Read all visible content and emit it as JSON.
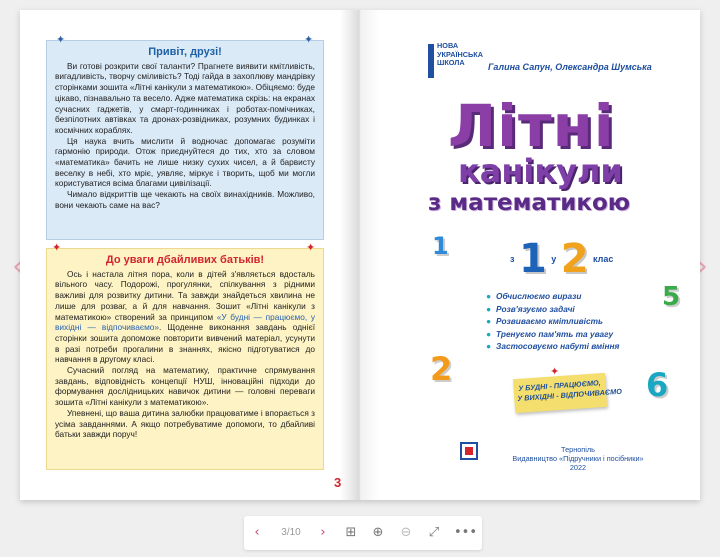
{
  "left_page": {
    "greeting": {
      "title": "Привіт, друзі!",
      "paragraphs": [
        "Ви готові розкрити свої таланти? Прагнете виявити кмітливість, вигадливість, творчу сміливість? Тоді гайда в захоплюву мандрівку сторінками зошита «Літні канікули з математикою». Обіцяємо: буде цікаво, пізнавально та весело. Адже математика скрізь: на екранах сучасних гаджетів, у смарт-годинниках і роботах-помічниках, безпілотних автівках та дронах-розвідниках, розумних будинках і космічних кораблях.",
        "Ця наука вчить мислити й водночас допомагає розуміти гармонію природи. Отож приєднуйтеся до тих, хто за словом «математика» бачить не лише низку сухих чисел, а й барвисту веселку в небі, хто мріє, уявляє, міркує і творить, щоб ми могли користуватися всіма благами цивілізації.",
        "Чимало відкриттів ще чекають на своїх винахідників. Можливо, вони чекають саме на вас?"
      ]
    },
    "parents": {
      "title": "До уваги дбайливих батьків!",
      "p1": "Ось і настала літня пора, коли в дітей з'являється вдосталь вільного часу. Подорожі, прогулянки, спілкування з рідними важливі для розвитку дитини. Та завжди знайдеться хвилина не лише для розваг, а й для навчання. Зошит «Літні канікули з математикою» створений за принципом ",
      "p1_link": "«У будні — працюємо, у вихідні — відпочиваємо»",
      "p1_tail": ". Щоденне виконання завдань однієї сторінки зошита допоможе повторити вивчений матеріал, усунути в разі потреби прогалини в знаннях, якісно підготуватися до навчання в другому класі.",
      "p2": "Сучасний погляд на математику, практичне спрямування завдань, відповідність концепції НУШ, інноваційні підходи до формування дослідницьких навичок дитини — головні переваги зошита «Літні канікули з математикою».",
      "p3": "Упевнені, що ваша дитина залюбки працюватиме і впорається з усіма завданнями. А якщо потребуватиме допомоги, то дбайливі батьки завжди поруч!"
    },
    "page_number": "3"
  },
  "right_page": {
    "logo": "НОВА УКРАЇНСЬКА ШКОЛА",
    "authors": "Галина Сапун, Олександра Шумська",
    "title_line1": "Літні",
    "title_line2": "канікули",
    "title_line3": "з математикою",
    "grade": {
      "prefix": "з",
      "from": "1",
      "middle": "у",
      "to": "2",
      "suffix": "клас"
    },
    "deco_digits": [
      "1",
      "5",
      "2",
      "6"
    ],
    "features": [
      "Обчислюємо вирази",
      "Розв'язуємо задачі",
      "Розвиваємо кмітливість",
      "Тренуємо пам'ять та увагу",
      "Застосовуємо набуті вміння"
    ],
    "sticker": [
      "У БУДНІ - ПРАЦЮЄМО,",
      "У ВИХІДНІ - ВІДПОЧИВАЄМО"
    ],
    "publisher_city": "Тернопіль",
    "publisher_name": "Видавництво «Підручники і посібники»",
    "year": "2022"
  },
  "toolbar": {
    "pages": "3/10",
    "icons": {
      "prev": "chevron-left-icon",
      "next": "chevron-right-icon",
      "grid": "grid-icon",
      "zoom_in": "zoom-in-icon",
      "zoom_out": "zoom-out-icon",
      "fullscreen": "fullscreen-icon",
      "more": "more-icon"
    }
  },
  "colors": {
    "accent_purple": "#8b3fa6",
    "brand_blue": "#1f4fa0",
    "alert_red": "#d3262c",
    "note_blue_bg": "#dbeaf7",
    "note_yellow_bg": "#fdf3c4"
  }
}
